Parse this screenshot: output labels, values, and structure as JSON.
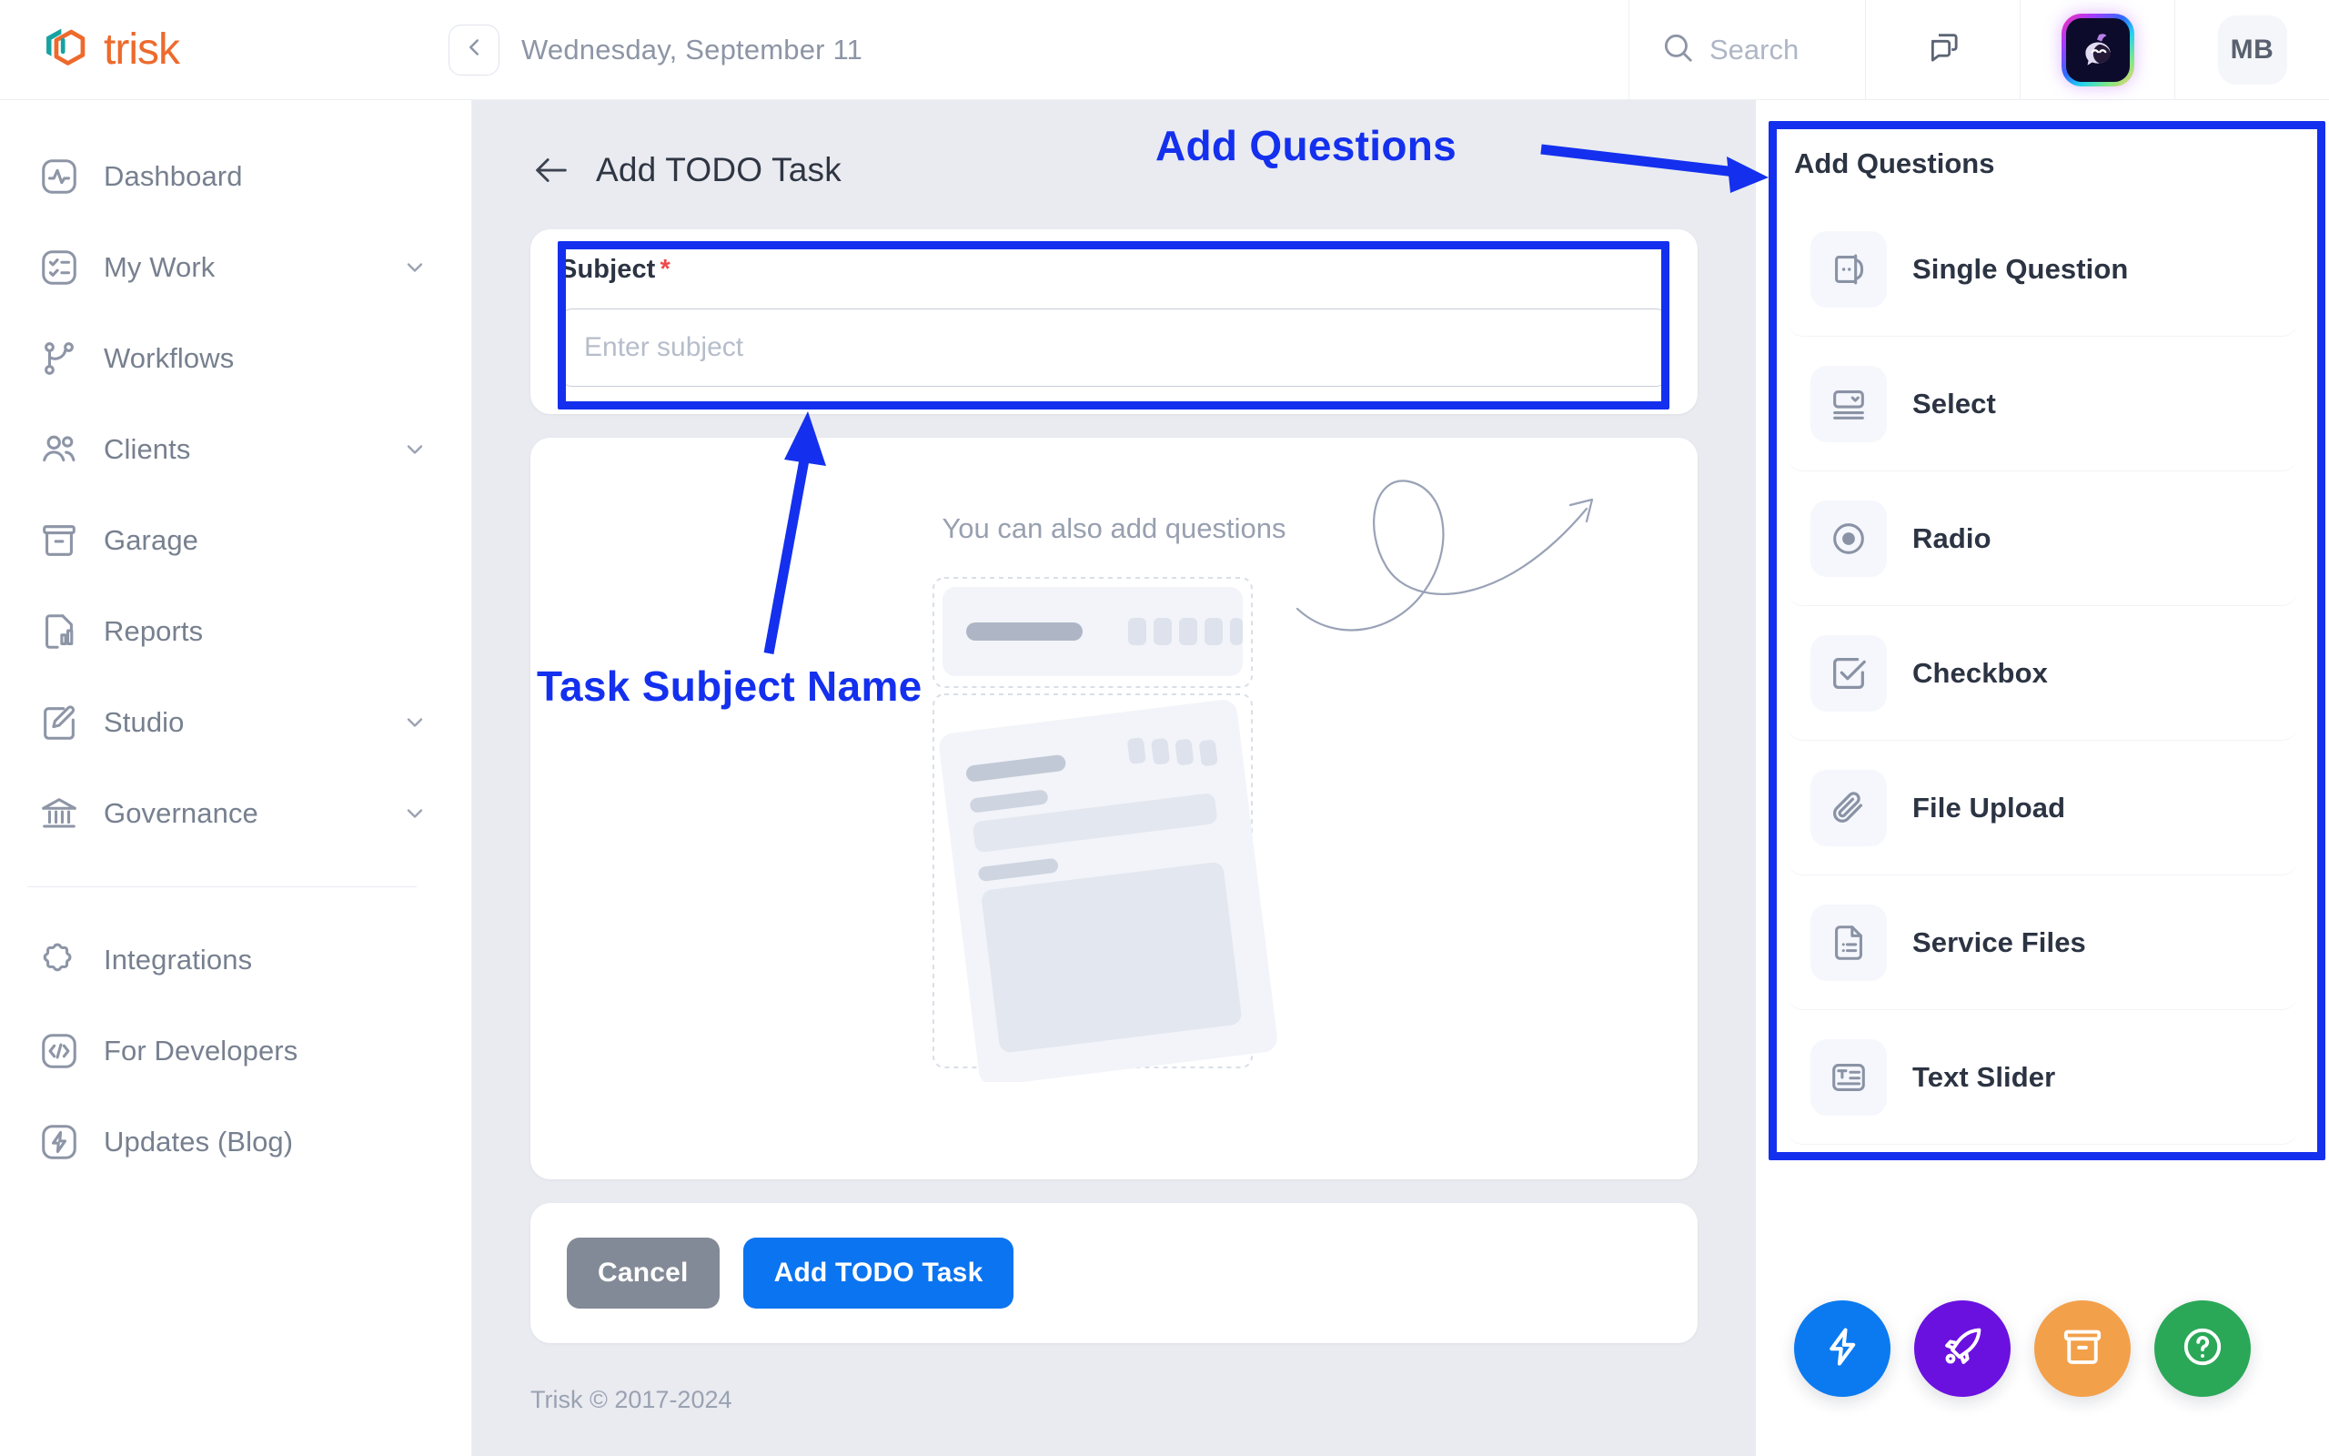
{
  "brand": {
    "name": "trisk",
    "logo_icon": "trisk-hexagon-logo"
  },
  "topbar": {
    "collapse_icon": "chevron-left-icon",
    "date": "Wednesday, September 11",
    "search": {
      "label": "Search",
      "icon": "search-icon"
    },
    "chat_icon": "chat-bubbles-icon",
    "mascot_icon": "mascot-avatar-icon",
    "avatar_initials": "MB"
  },
  "sidebar": {
    "items": [
      {
        "label": "Dashboard",
        "icon": "dashboard-pulse-icon",
        "expandable": false
      },
      {
        "label": "My Work",
        "icon": "checklist-icon",
        "expandable": true
      },
      {
        "label": "Workflows",
        "icon": "workflow-branch-icon",
        "expandable": false
      },
      {
        "label": "Clients",
        "icon": "users-icon",
        "expandable": true
      },
      {
        "label": "Garage",
        "icon": "archive-box-icon",
        "expandable": false
      },
      {
        "label": "Reports",
        "icon": "report-chart-icon",
        "expandable": false
      },
      {
        "label": "Studio",
        "icon": "brush-edit-icon",
        "expandable": true
      },
      {
        "label": "Governance",
        "icon": "bank-columns-icon",
        "expandable": true
      }
    ],
    "secondary_items": [
      {
        "label": "Integrations",
        "icon": "puzzle-piece-icon"
      },
      {
        "label": "For Developers",
        "icon": "code-brackets-icon"
      },
      {
        "label": "Updates (Blog)",
        "icon": "lightning-bolt-icon"
      }
    ]
  },
  "main": {
    "back_icon": "arrow-left-icon",
    "title": "Add TODO Task",
    "subject": {
      "label": "Subject",
      "required_marker": "*",
      "placeholder": "Enter subject",
      "value": ""
    },
    "empty_state": {
      "caption": "You can also add questions"
    },
    "actions": {
      "cancel": "Cancel",
      "submit": "Add TODO Task"
    },
    "footer": "Trisk © 2017-2024"
  },
  "right_panel": {
    "title": "Add Questions",
    "items": [
      {
        "label": "Single Question",
        "icon": "single-question-icon"
      },
      {
        "label": "Select",
        "icon": "select-dropdown-icon"
      },
      {
        "label": "Radio",
        "icon": "radio-button-icon"
      },
      {
        "label": "Checkbox",
        "icon": "checkbox-icon"
      },
      {
        "label": "File Upload",
        "icon": "paperclip-icon"
      },
      {
        "label": "Service Files",
        "icon": "service-file-icon"
      },
      {
        "label": "Text Slider",
        "icon": "text-slider-icon"
      }
    ]
  },
  "fabs": [
    {
      "icon": "lightning-bolt-icon",
      "color": "#0b7af0"
    },
    {
      "icon": "rocket-icon",
      "color": "#6a11e0"
    },
    {
      "icon": "archive-box-icon",
      "color": "#f3a04a"
    },
    {
      "icon": "question-mark-icon",
      "color": "#2aa858"
    }
  ],
  "annotations": {
    "color": "#1430ee",
    "labels": [
      {
        "text": "Add Questions",
        "name": "annotation-add-questions"
      },
      {
        "text": "Task Subject Name",
        "name": "annotation-task-subject-name"
      }
    ]
  }
}
